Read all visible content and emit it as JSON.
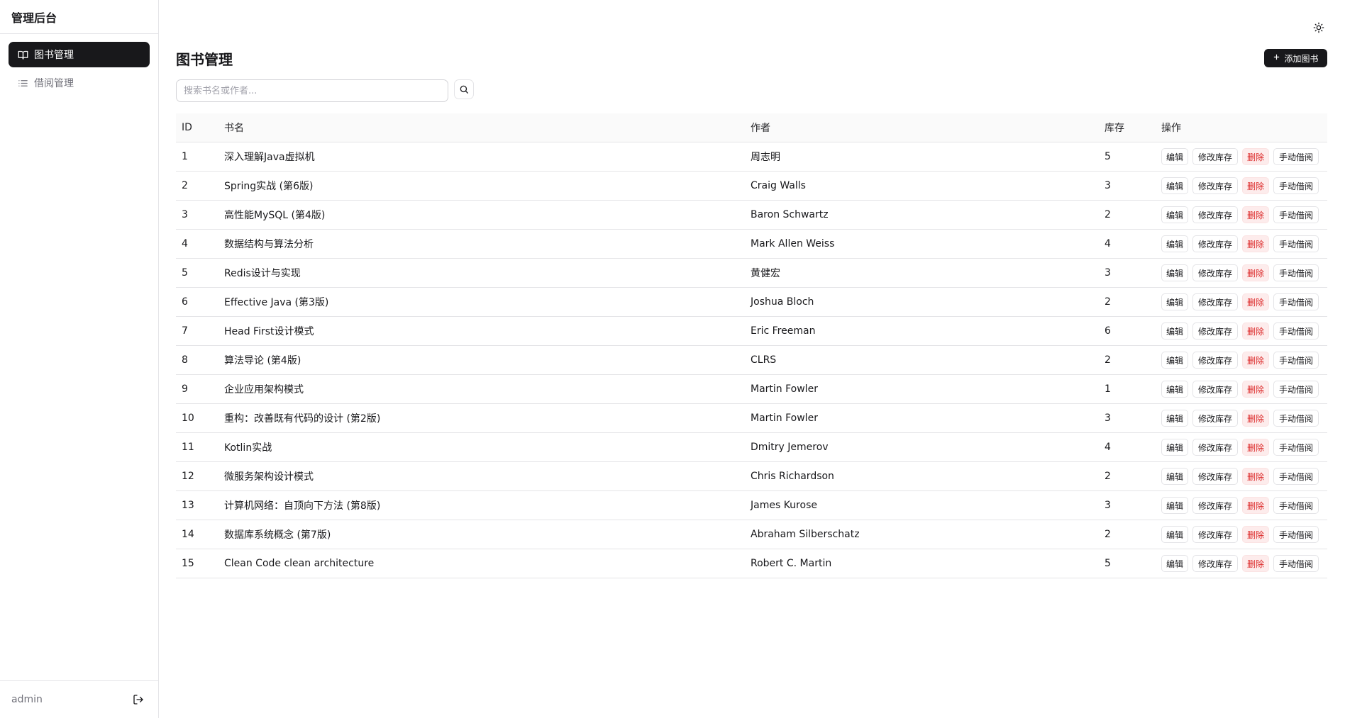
{
  "app": {
    "title": "管理后台"
  },
  "sidebar": {
    "items": [
      {
        "label": "图书管理",
        "icon": "book-open-icon",
        "active": true
      },
      {
        "label": "借阅管理",
        "icon": "list-icon",
        "active": false
      }
    ],
    "user": "admin"
  },
  "header": {
    "title": "图书管理",
    "add_label": "添加图书"
  },
  "search": {
    "placeholder": "搜索书名或作者..."
  },
  "table": {
    "headers": {
      "id": "ID",
      "title": "书名",
      "author": "作者",
      "stock": "库存",
      "actions": "操作"
    },
    "actions": {
      "edit": "编辑",
      "stock": "修改库存",
      "delete": "删除",
      "borrow": "手动借阅"
    },
    "rows": [
      {
        "id": "1",
        "title": "深入理解Java虚拟机",
        "author": "周志明",
        "stock": "5"
      },
      {
        "id": "2",
        "title": "Spring实战 (第6版)",
        "author": "Craig Walls",
        "stock": "3"
      },
      {
        "id": "3",
        "title": "高性能MySQL (第4版)",
        "author": "Baron Schwartz",
        "stock": "2"
      },
      {
        "id": "4",
        "title": "数据结构与算法分析",
        "author": "Mark Allen Weiss",
        "stock": "4"
      },
      {
        "id": "5",
        "title": "Redis设计与实现",
        "author": "黄健宏",
        "stock": "3"
      },
      {
        "id": "6",
        "title": "Effective Java (第3版)",
        "author": "Joshua Bloch",
        "stock": "2"
      },
      {
        "id": "7",
        "title": "Head First设计模式",
        "author": "Eric Freeman",
        "stock": "6"
      },
      {
        "id": "8",
        "title": "算法导论 (第4版)",
        "author": "CLRS",
        "stock": "2"
      },
      {
        "id": "9",
        "title": "企业应用架构模式",
        "author": "Martin Fowler",
        "stock": "1"
      },
      {
        "id": "10",
        "title": "重构：改善既有代码的设计 (第2版)",
        "author": "Martin Fowler",
        "stock": "3"
      },
      {
        "id": "11",
        "title": "Kotlin实战",
        "author": "Dmitry Jemerov",
        "stock": "4"
      },
      {
        "id": "12",
        "title": "微服务架构设计模式",
        "author": "Chris Richardson",
        "stock": "2"
      },
      {
        "id": "13",
        "title": "计算机网络：自顶向下方法 (第8版)",
        "author": "James Kurose",
        "stock": "3"
      },
      {
        "id": "14",
        "title": "数据库系统概念 (第7版)",
        "author": "Abraham Silberschatz",
        "stock": "2"
      },
      {
        "id": "15",
        "title": "Clean Code clean architecture",
        "author": "Robert C. Martin",
        "stock": "5"
      }
    ]
  },
  "colors": {
    "primary": "#18181b",
    "danger": "#dc2626",
    "danger_bg": "#fdecec",
    "border": "#e4e4e7",
    "muted": "#71717a"
  }
}
